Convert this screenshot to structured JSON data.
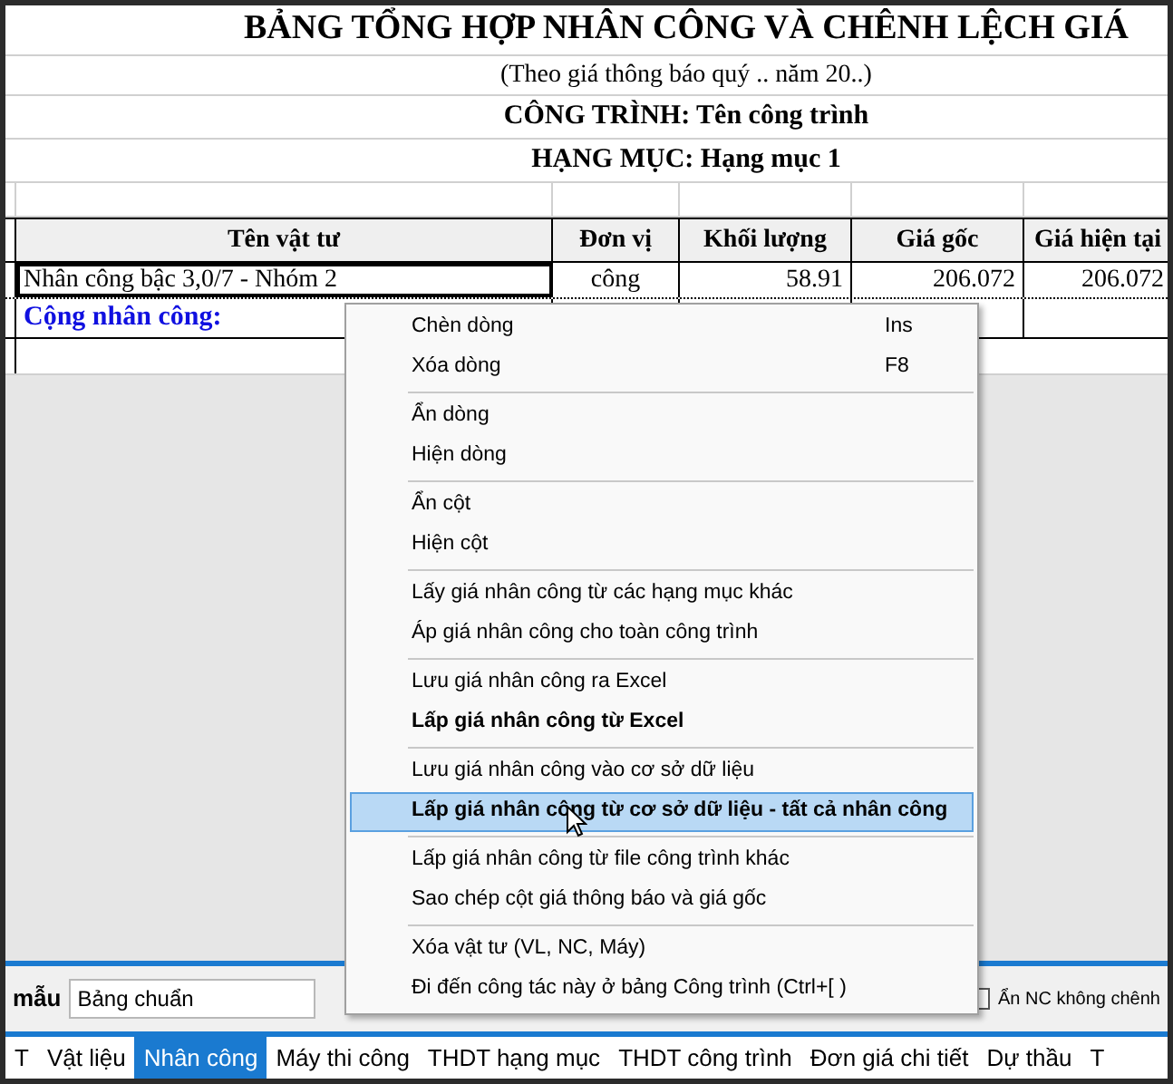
{
  "sheet": {
    "title": "BẢNG TỔNG HỢP NHÂN CÔNG VÀ CHÊNH LỆCH GIÁ",
    "subtitle": "(Theo giá thông báo quý .. năm 20..)",
    "project": "CÔNG TRÌNH: Tên công trình",
    "category": "HẠNG MỤC: Hạng mục 1",
    "columns": [
      "Tên vật tư",
      "Đơn vị",
      "Khối lượng",
      "Giá gốc",
      "Giá hiện tại"
    ],
    "rows": [
      {
        "cells": [
          "Nhân công bậc 3,0/7 - Nhóm 2",
          "công",
          "58.91",
          "206.072",
          "206.072"
        ],
        "selected": true
      }
    ],
    "total_label": "Cộng nhân công:"
  },
  "context_menu": [
    [
      {
        "label": "Chèn dòng",
        "shortcut": "Ins",
        "bold": false,
        "selected": false
      },
      {
        "label": "Xóa dòng",
        "shortcut": "F8",
        "bold": false,
        "selected": false
      }
    ],
    [
      {
        "label": "Ẩn dòng",
        "bold": false,
        "selected": false
      },
      {
        "label": "Hiện dòng",
        "bold": false,
        "selected": false
      }
    ],
    [
      {
        "label": "Ẩn cột",
        "bold": false,
        "selected": false
      },
      {
        "label": "Hiện cột",
        "bold": false,
        "selected": false
      }
    ],
    [
      {
        "label": "Lấy giá nhân công từ các hạng mục khác",
        "bold": false,
        "selected": false
      },
      {
        "label": "Áp giá nhân công cho toàn công trình",
        "bold": false,
        "selected": false
      }
    ],
    [
      {
        "label": "Lưu giá nhân công ra Excel",
        "bold": false,
        "selected": false
      },
      {
        "label": "Lấp giá nhân công từ Excel",
        "bold": true,
        "selected": false
      }
    ],
    [
      {
        "label": "Lưu giá nhân công vào cơ sở dữ liệu",
        "bold": false,
        "selected": false
      },
      {
        "label": "Lấp giá nhân công từ cơ sở dữ liệu - tất cả nhân công",
        "bold": true,
        "selected": true
      }
    ],
    [
      {
        "label": "Lấp giá nhân công từ file công trình khác",
        "bold": false,
        "selected": false
      },
      {
        "label": "Sao chép cột giá thông báo và giá gốc",
        "bold": false,
        "selected": false
      }
    ],
    [
      {
        "label": "Xóa vật tư (VL, NC, Máy)",
        "bold": false,
        "selected": false
      },
      {
        "label": "Đi đến công tác này ở bảng Công trình (Ctrl+[ )",
        "bold": false,
        "selected": false
      }
    ]
  ],
  "toolbar": {
    "label": "mẫu",
    "template": "Bảng chuẩn",
    "checkbox": {
      "label": "Ẩn NC không chênh",
      "checked": false
    }
  },
  "tabs": [
    {
      "label": "T",
      "selected": false
    },
    {
      "label": "Vật liệu",
      "selected": false
    },
    {
      "label": "Nhân công",
      "selected": true
    },
    {
      "label": "Máy thi công",
      "selected": false
    },
    {
      "label": "THDT hạng mục",
      "selected": false
    },
    {
      "label": "THDT công trình",
      "selected": false
    },
    {
      "label": "Đơn giá chi tiết",
      "selected": false
    },
    {
      "label": "Dự thầu",
      "selected": false
    },
    {
      "label": "T",
      "selected": false
    }
  ]
}
